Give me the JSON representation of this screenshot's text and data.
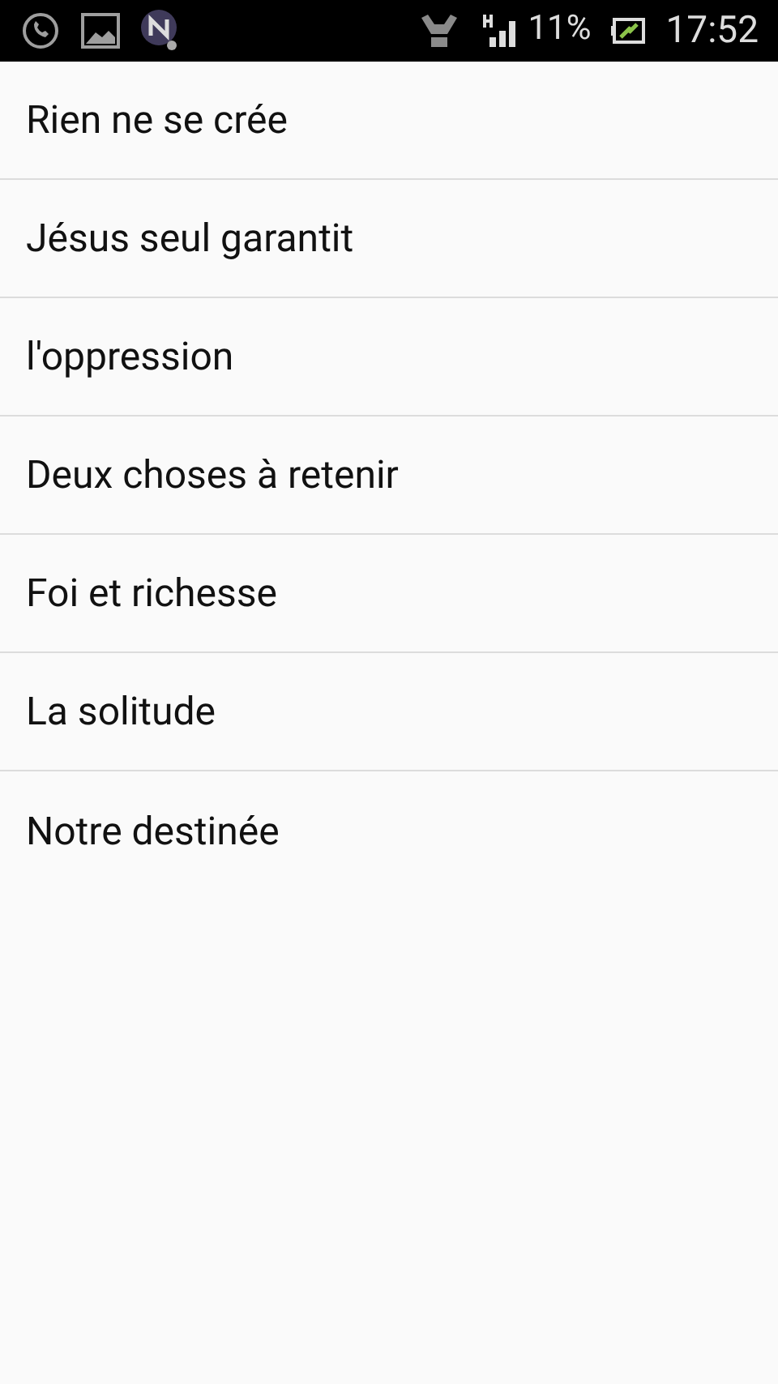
{
  "status_bar": {
    "battery": "11%",
    "time": "17:52"
  },
  "items": [
    {
      "label": "Rien ne se crée"
    },
    {
      "label": "Jésus seul garantit"
    },
    {
      "label": "l'oppression"
    },
    {
      "label": "Deux choses à retenir"
    },
    {
      "label": "Foi et richesse"
    },
    {
      "label": "La solitude"
    },
    {
      "label": "Notre destinée"
    }
  ]
}
